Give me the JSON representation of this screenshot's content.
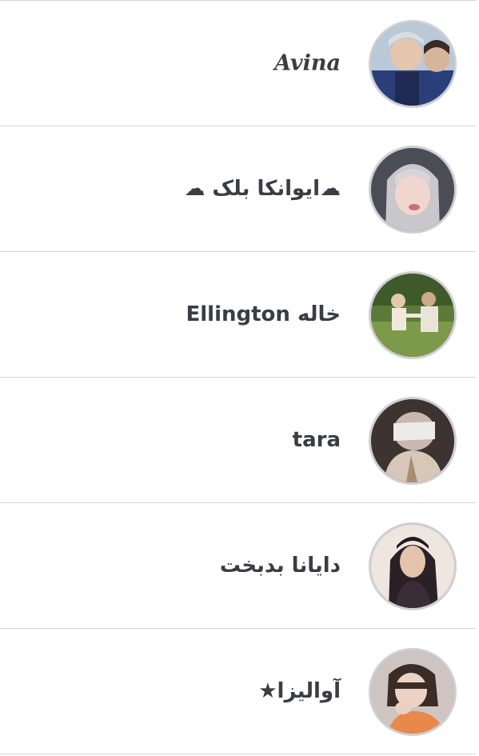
{
  "contacts": [
    {
      "name": "Avina",
      "avatar": "avatar-photo",
      "style": "serif-italic"
    },
    {
      "name": "☁ایوانکا بلک ☁",
      "avatar": "avatar-photo"
    },
    {
      "name": "خاله Ellington",
      "avatar": "avatar-photo"
    },
    {
      "name": "tara",
      "avatar": "avatar-photo"
    },
    {
      "name": "دایانا بدبخت",
      "avatar": "avatar-photo"
    },
    {
      "name": "آوالیزا★",
      "avatar": "avatar-photo"
    }
  ],
  "colors": {
    "name_text": "#3b3c44",
    "divider": "#d4d4d8",
    "avatar_border": "#cfcfd4"
  }
}
